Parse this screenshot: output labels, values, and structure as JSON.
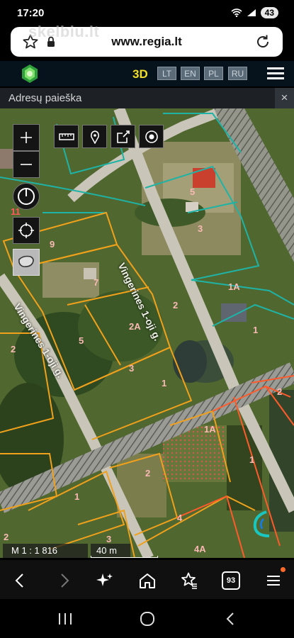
{
  "status": {
    "time": "17:20",
    "battery": "43"
  },
  "browser": {
    "url": "www.regia.lt",
    "watermark": "skelbiu.lt"
  },
  "header": {
    "view_3d": "3D",
    "languages": [
      "LT",
      "EN",
      "PL",
      "RU"
    ]
  },
  "search": {
    "label": "Adresų paieška",
    "close": "×"
  },
  "map": {
    "street_labels": [
      "Vingerines 1-oji g.",
      "Vingerines 1-oji g."
    ],
    "parcel_numbers": [
      "5",
      "3",
      "11",
      "9",
      "7",
      "2",
      "1A",
      "1",
      "2A",
      "2",
      "5",
      "3",
      "1",
      "2",
      "1A",
      "1",
      "2",
      "1",
      "4",
      "3",
      "2",
      "4A"
    ],
    "scale": "M 1 : 1 816",
    "scale_length": "40 m"
  },
  "colors": {
    "teal": "#1fb3a6",
    "orange": "#f0a11c",
    "red": "#ff5a2a",
    "road": "#c9c5b8",
    "header": "#06121c",
    "accent": "#f2dd2a"
  },
  "icons": [
    "star-icon",
    "lock-icon",
    "reload-icon",
    "logo-icon",
    "menu-icon",
    "zoom-in-icon",
    "zoom-out-icon",
    "measure-icon",
    "marker-icon",
    "share-icon",
    "target-icon",
    "compass-icon",
    "locate-icon",
    "select-area-icon",
    "back-icon",
    "forward-icon",
    "sparkle-icon",
    "home-icon",
    "bookmarks-icon",
    "tabs-icon",
    "browser-menu-icon",
    "recents-icon",
    "android-home-icon",
    "android-back-icon"
  ],
  "tabs_count": "93"
}
